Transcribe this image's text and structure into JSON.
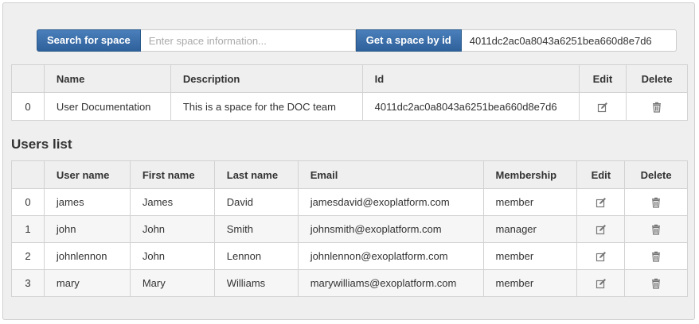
{
  "search": {
    "search_button": "Search for space",
    "search_placeholder": "Enter space information...",
    "search_value": "",
    "getid_button": "Get a space by id",
    "space_id_value": "4011dc2ac0a8043a6251bea660d8e7d6"
  },
  "space_table": {
    "headers": [
      "",
      "Name",
      "Description",
      "Id",
      "Edit",
      "Delete"
    ],
    "rows": [
      {
        "index": "0",
        "name": "User Documentation",
        "description": "This is a space for the DOC team",
        "id": "4011dc2ac0a8043a6251bea660d8e7d6",
        "edit_icon": "edit-icon",
        "delete_icon": "trash-icon"
      }
    ]
  },
  "users_section": {
    "title": "Users list"
  },
  "users_table": {
    "headers": [
      "",
      "User name",
      "First name",
      "Last name",
      "Email",
      "Membership",
      "Edit",
      "Delete"
    ],
    "rows": [
      {
        "index": "0",
        "username": "james",
        "first": "James",
        "last": "David",
        "email": "jamesdavid@exoplatform.com",
        "membership": "member"
      },
      {
        "index": "1",
        "username": "john",
        "first": "John",
        "last": "Smith",
        "email": "johnsmith@exoplatform.com",
        "membership": "manager"
      },
      {
        "index": "2",
        "username": "johnlennon",
        "first": "John",
        "last": "Lennon",
        "email": "johnlennon@exoplatform.com",
        "membership": "member"
      },
      {
        "index": "3",
        "username": "mary",
        "first": "Mary",
        "last": "Williams",
        "email": "marywilliams@exoplatform.com",
        "membership": "member"
      }
    ]
  },
  "colors": {
    "button": "#3569a6",
    "panel_bg": "#efefef",
    "header_bg": "#efefef",
    "border": "#d2d2d2"
  }
}
